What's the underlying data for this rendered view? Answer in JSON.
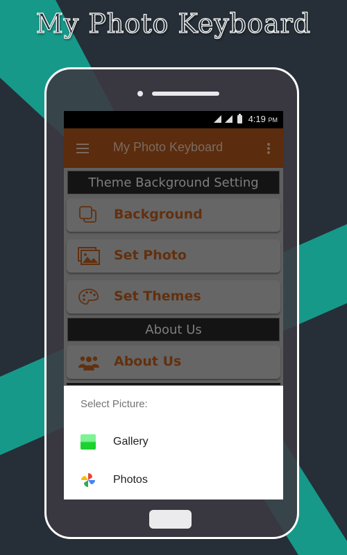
{
  "promo": {
    "title": "My Photo Keyboard"
  },
  "colors": {
    "teal": "#17998a",
    "background": "#262f37",
    "appbar": "#5b2c0d",
    "accent_text": "#62300f",
    "sheet_bg": "#ffffff"
  },
  "statusbar": {
    "time": "4:19",
    "ampm": "PM"
  },
  "appbar": {
    "title": "My Photo Keyboard",
    "menu_icon": "hamburger-icon",
    "overflow_icon": "more-vert-icon"
  },
  "sections": [
    {
      "header": "Theme Background Setting",
      "items": [
        {
          "label": "Background",
          "icon": "layers-icon"
        },
        {
          "label": "Set Photo",
          "icon": "photo-library-icon"
        },
        {
          "label": "Set Themes",
          "icon": "palette-icon"
        }
      ]
    },
    {
      "header": "About Us",
      "items": [
        {
          "label": "About Us",
          "icon": "people-icon"
        }
      ]
    }
  ],
  "chooser": {
    "title": "Select Picture:",
    "options": [
      {
        "label": "Gallery",
        "icon": "gallery-icon"
      },
      {
        "label": "Photos",
        "icon": "google-photos-icon"
      }
    ]
  }
}
